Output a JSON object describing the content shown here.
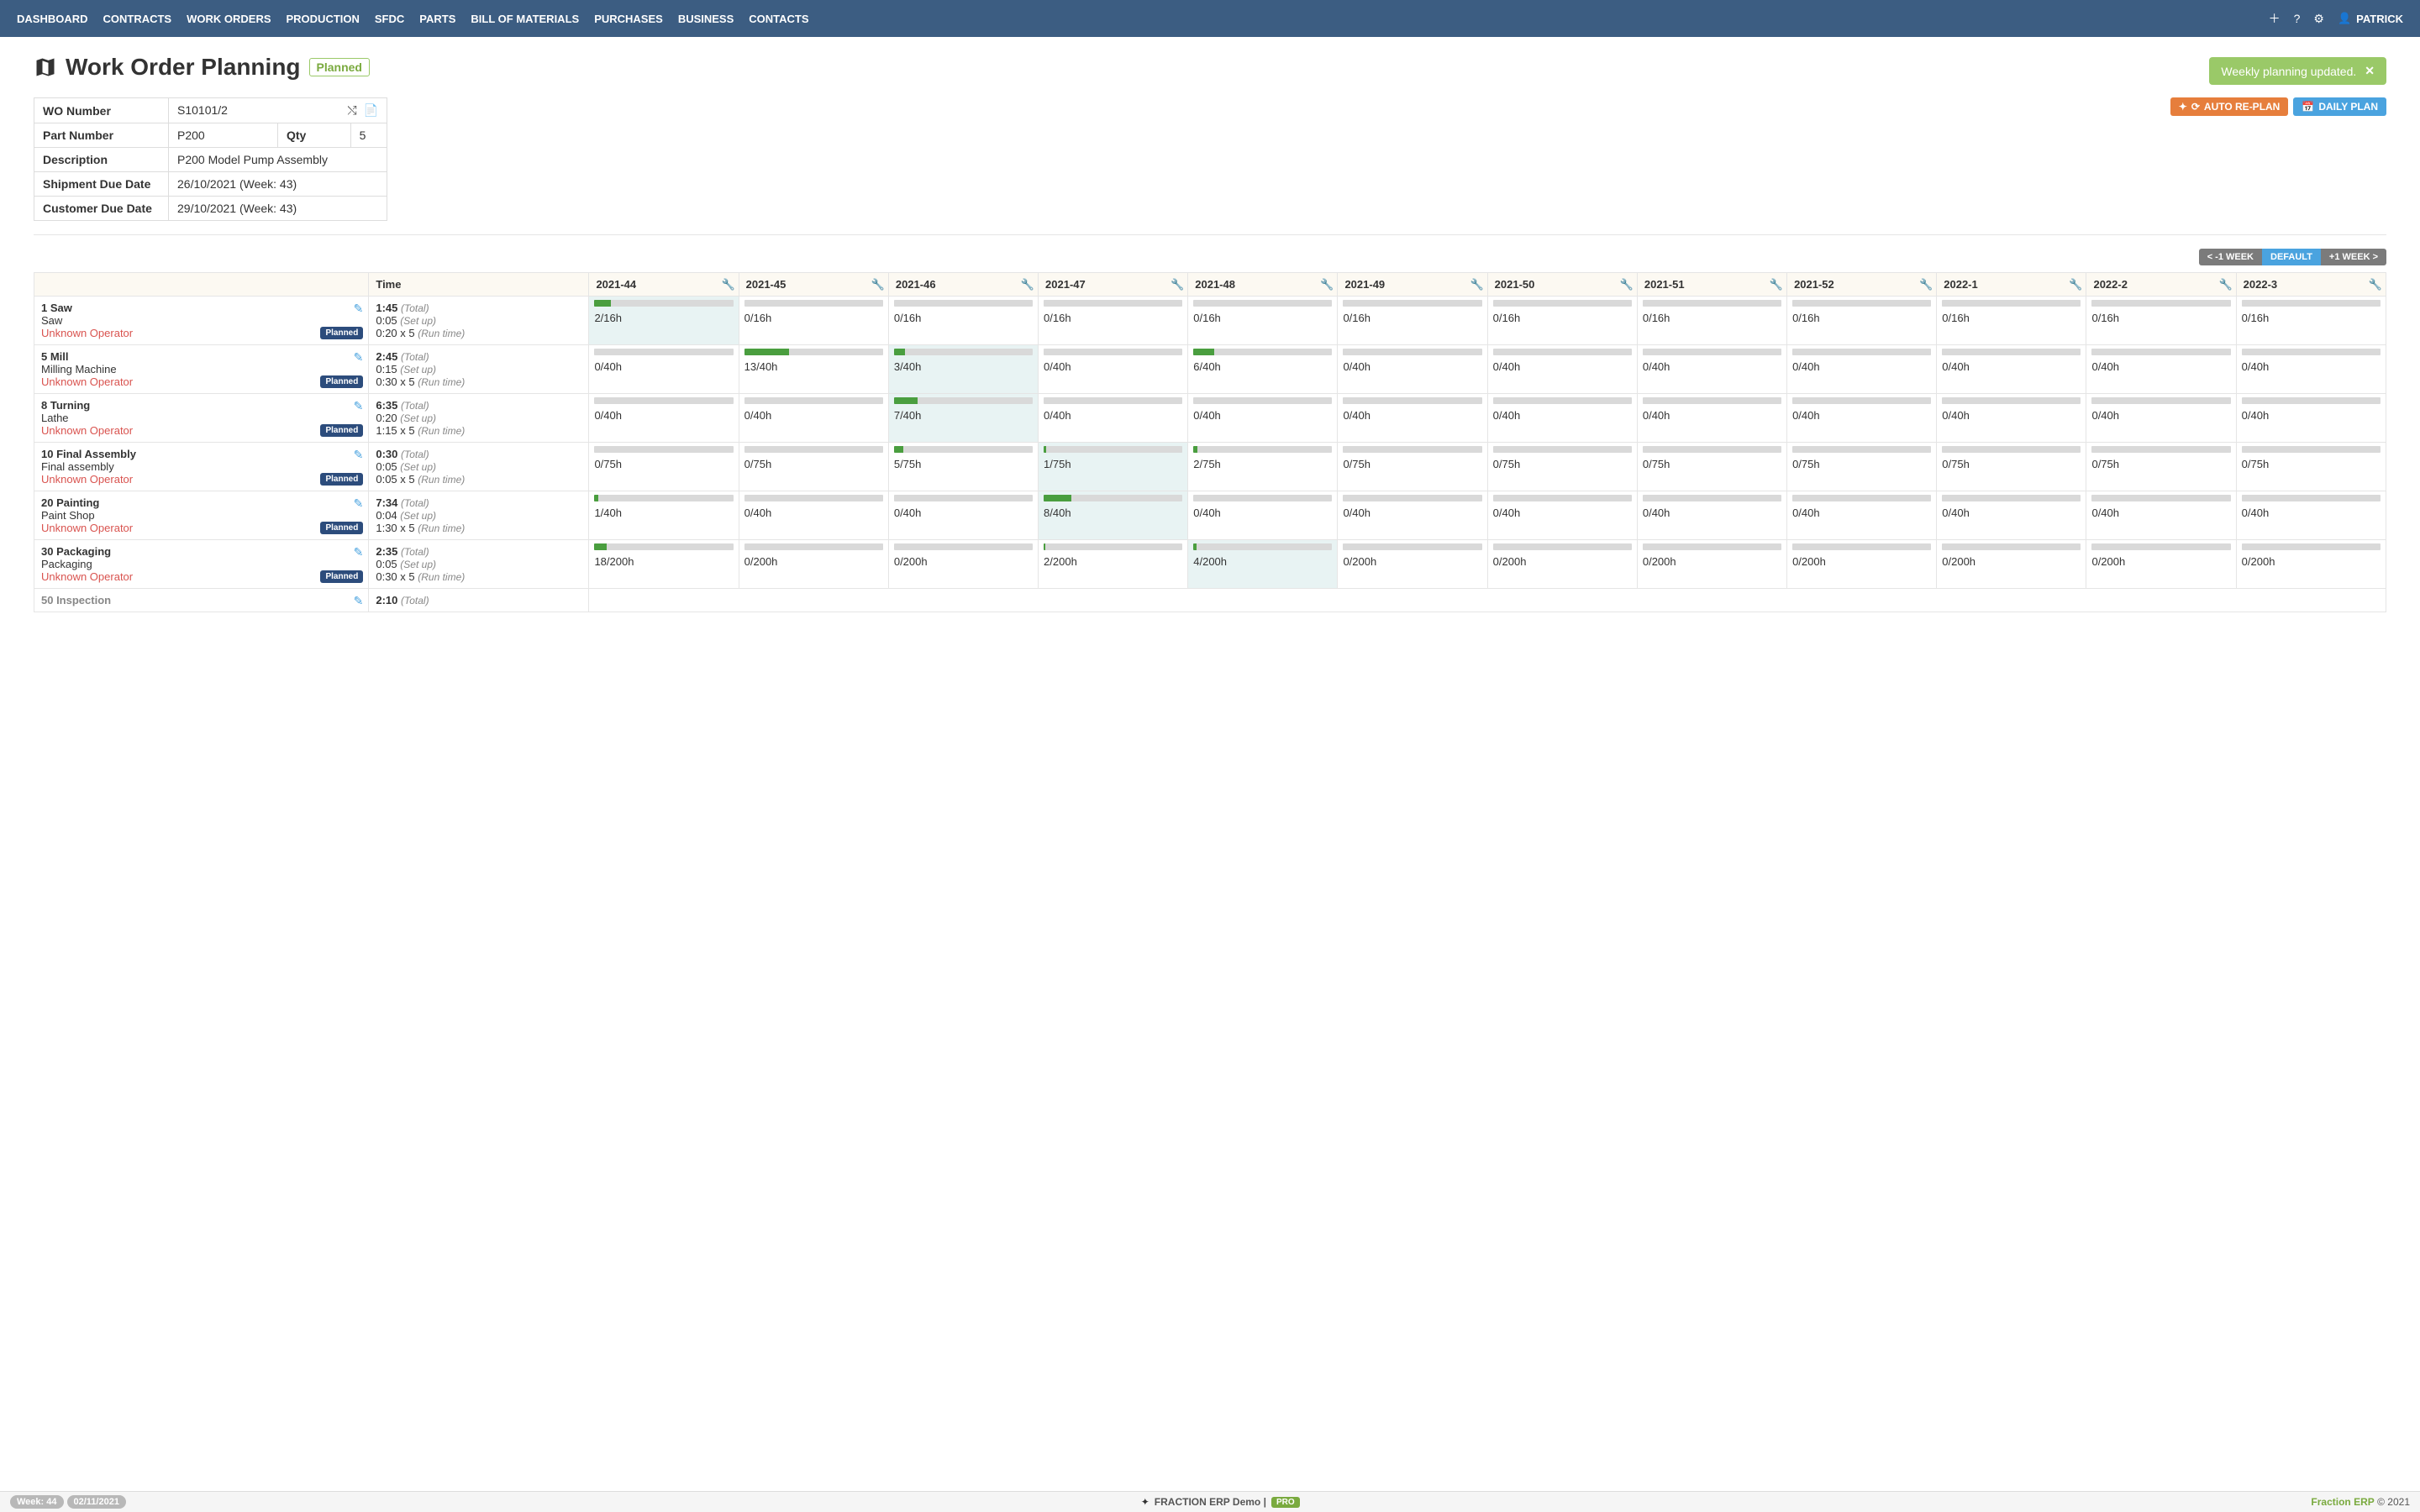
{
  "nav": {
    "items": [
      "DASHBOARD",
      "CONTRACTS",
      "WORK ORDERS",
      "PRODUCTION",
      "SFDC",
      "PARTS",
      "BILL OF MATERIALS",
      "PURCHASES",
      "BUSINESS",
      "CONTACTS"
    ],
    "user": "PATRICK"
  },
  "toast": {
    "text": "Weekly planning updated."
  },
  "page": {
    "title": "Work Order Planning",
    "status": "Planned"
  },
  "info": {
    "wo_label": "WO Number",
    "wo_value": "S10101/2",
    "part_label": "Part Number",
    "part_value": "P200",
    "qty_label": "Qty",
    "qty_value": "5",
    "desc_label": "Description",
    "desc_value": "P200 Model Pump Assembly",
    "ship_label": "Shipment Due Date",
    "ship_value": "26/10/2021 (Week: 43)",
    "cust_label": "Customer Due Date",
    "cust_value": "29/10/2021 (Week: 43)"
  },
  "actions": {
    "replan": "AUTO RE-PLAN",
    "daily": "DAILY PLAN"
  },
  "week_ctrl": {
    "prev": "< -1 WEEK",
    "def": "DEFAULT",
    "next": "+1 WEEK >"
  },
  "table": {
    "head_time": "Time",
    "weeks": [
      "2021-44",
      "2021-45",
      "2021-46",
      "2021-47",
      "2021-48",
      "2021-49",
      "2021-50",
      "2021-51",
      "2021-52",
      "2022-1",
      "2022-2",
      "2022-3"
    ],
    "planned_badge": "Planned",
    "operator": "Unknown Operator",
    "total_label": "(Total)",
    "setup_label": "(Set up)",
    "run_label": "(Run time)",
    "rows": [
      {
        "name": "1 Saw",
        "desc": "Saw",
        "total": "1:45",
        "setup": "0:05",
        "run": "0:20 x 5",
        "active": 0,
        "cells": [
          {
            "t": "2/16h",
            "p": 12
          },
          {
            "t": "0/16h",
            "p": 0
          },
          {
            "t": "0/16h",
            "p": 0
          },
          {
            "t": "0/16h",
            "p": 0
          },
          {
            "t": "0/16h",
            "p": 0
          },
          {
            "t": "0/16h",
            "p": 0
          },
          {
            "t": "0/16h",
            "p": 0
          },
          {
            "t": "0/16h",
            "p": 0
          },
          {
            "t": "0/16h",
            "p": 0
          },
          {
            "t": "0/16h",
            "p": 0
          },
          {
            "t": "0/16h",
            "p": 0
          },
          {
            "t": "0/16h",
            "p": 0
          }
        ]
      },
      {
        "name": "5 Mill",
        "desc": "Milling Machine",
        "total": "2:45",
        "setup": "0:15",
        "run": "0:30 x 5",
        "active": 2,
        "cells": [
          {
            "t": "0/40h",
            "p": 0
          },
          {
            "t": "13/40h",
            "p": 32
          },
          {
            "t": "3/40h",
            "p": 8
          },
          {
            "t": "0/40h",
            "p": 0
          },
          {
            "t": "6/40h",
            "p": 15
          },
          {
            "t": "0/40h",
            "p": 0
          },
          {
            "t": "0/40h",
            "p": 0
          },
          {
            "t": "0/40h",
            "p": 0
          },
          {
            "t": "0/40h",
            "p": 0
          },
          {
            "t": "0/40h",
            "p": 0
          },
          {
            "t": "0/40h",
            "p": 0
          },
          {
            "t": "0/40h",
            "p": 0
          }
        ]
      },
      {
        "name": "8 Turning",
        "desc": "Lathe",
        "total": "6:35",
        "setup": "0:20",
        "run": "1:15 x 5",
        "active": 2,
        "cells": [
          {
            "t": "0/40h",
            "p": 0
          },
          {
            "t": "0/40h",
            "p": 0
          },
          {
            "t": "7/40h",
            "p": 17
          },
          {
            "t": "0/40h",
            "p": 0
          },
          {
            "t": "0/40h",
            "p": 0
          },
          {
            "t": "0/40h",
            "p": 0
          },
          {
            "t": "0/40h",
            "p": 0
          },
          {
            "t": "0/40h",
            "p": 0
          },
          {
            "t": "0/40h",
            "p": 0
          },
          {
            "t": "0/40h",
            "p": 0
          },
          {
            "t": "0/40h",
            "p": 0
          },
          {
            "t": "0/40h",
            "p": 0
          }
        ]
      },
      {
        "name": "10 Final Assembly",
        "desc": "Final assembly",
        "total": "0:30",
        "setup": "0:05",
        "run": "0:05 x 5",
        "active": 3,
        "cells": [
          {
            "t": "0/75h",
            "p": 0
          },
          {
            "t": "0/75h",
            "p": 0
          },
          {
            "t": "5/75h",
            "p": 7
          },
          {
            "t": "1/75h",
            "p": 2
          },
          {
            "t": "2/75h",
            "p": 3
          },
          {
            "t": "0/75h",
            "p": 0
          },
          {
            "t": "0/75h",
            "p": 0
          },
          {
            "t": "0/75h",
            "p": 0
          },
          {
            "t": "0/75h",
            "p": 0
          },
          {
            "t": "0/75h",
            "p": 0
          },
          {
            "t": "0/75h",
            "p": 0
          },
          {
            "t": "0/75h",
            "p": 0
          }
        ]
      },
      {
        "name": "20 Painting",
        "desc": "Paint Shop",
        "total": "7:34",
        "setup": "0:04",
        "run": "1:30 x 5",
        "active": 3,
        "cells": [
          {
            "t": "1/40h",
            "p": 3
          },
          {
            "t": "0/40h",
            "p": 0
          },
          {
            "t": "0/40h",
            "p": 0
          },
          {
            "t": "8/40h",
            "p": 20
          },
          {
            "t": "0/40h",
            "p": 0
          },
          {
            "t": "0/40h",
            "p": 0
          },
          {
            "t": "0/40h",
            "p": 0
          },
          {
            "t": "0/40h",
            "p": 0
          },
          {
            "t": "0/40h",
            "p": 0
          },
          {
            "t": "0/40h",
            "p": 0
          },
          {
            "t": "0/40h",
            "p": 0
          },
          {
            "t": "0/40h",
            "p": 0
          }
        ]
      },
      {
        "name": "30 Packaging",
        "desc": "Packaging",
        "total": "2:35",
        "setup": "0:05",
        "run": "0:30 x 5",
        "active": 4,
        "cells": [
          {
            "t": "18/200h",
            "p": 9
          },
          {
            "t": "0/200h",
            "p": 0
          },
          {
            "t": "0/200h",
            "p": 0
          },
          {
            "t": "2/200h",
            "p": 1
          },
          {
            "t": "4/200h",
            "p": 2
          },
          {
            "t": "0/200h",
            "p": 0
          },
          {
            "t": "0/200h",
            "p": 0
          },
          {
            "t": "0/200h",
            "p": 0
          },
          {
            "t": "0/200h",
            "p": 0
          },
          {
            "t": "0/200h",
            "p": 0
          },
          {
            "t": "0/200h",
            "p": 0
          },
          {
            "t": "0/200h",
            "p": 0
          }
        ]
      }
    ],
    "truncated": {
      "name": "50 Inspection",
      "total": "2:10"
    }
  },
  "footer": {
    "week": "Week: 44",
    "date": "02/11/2021",
    "brand_pre": "FRACTION ERP ",
    "brand_bold": "Demo",
    "brand_sep": " | ",
    "pro": "PRO",
    "right_brand": "Fraction ERP",
    "copy": " © 2021"
  }
}
